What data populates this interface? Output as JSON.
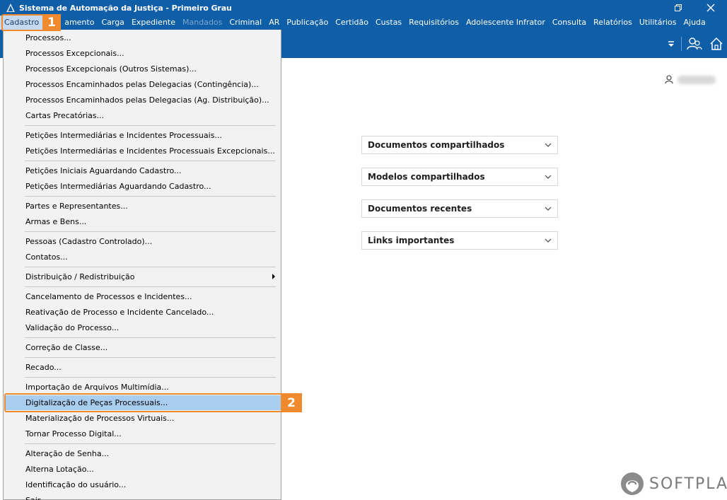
{
  "window": {
    "title": "Sistema de Automação da Justiça - Primeiro Grau"
  },
  "menubar": {
    "items": [
      {
        "label": "Cadastro",
        "state": "active"
      },
      {
        "label": "amento",
        "state": "normal"
      },
      {
        "label": "Carga",
        "state": "normal"
      },
      {
        "label": "Expediente",
        "state": "normal"
      },
      {
        "label": "Mandados",
        "state": "disabled"
      },
      {
        "label": "Criminal",
        "state": "normal"
      },
      {
        "label": "AR",
        "state": "normal"
      },
      {
        "label": "Publicação",
        "state": "normal"
      },
      {
        "label": "Certidão",
        "state": "normal"
      },
      {
        "label": "Custas",
        "state": "normal"
      },
      {
        "label": "Requisitórios",
        "state": "normal"
      },
      {
        "label": "Adolescente Infrator",
        "state": "normal"
      },
      {
        "label": "Consulta",
        "state": "normal"
      },
      {
        "label": "Relatórios",
        "state": "normal"
      },
      {
        "label": "Utilitários",
        "state": "normal"
      },
      {
        "label": "Ajuda",
        "state": "normal"
      }
    ]
  },
  "dropdown": {
    "items": [
      "Processos...",
      "Processos Excepcionais...",
      "Processos Excepcionais (Outros Sistemas)...",
      "Processos Encaminhados pelas Delegacias (Contingência)...",
      "Processos Encaminhados pelas Delegacias (Ag. Distribuição)...",
      "Cartas Precatórias...",
      "Petições Intermediárias e Incidentes Processuais...",
      "Petições Intermediárias e Incidentes Processuais Excepcionais...",
      "Petições Iniciais Aguardando Cadastro...",
      "Petições Intermediárias Aguardando Cadastro...",
      "Partes e Representantes...",
      "Armas e Bens...",
      "Pessoas (Cadastro Controlado)...",
      "Contatos...",
      "Distribuição / Redistribuição",
      "Cancelamento de Processos e Incidentes...",
      "Reativação de Processo e Incidente Cancelado...",
      "Validação do Processo...",
      "Correção de Classe...",
      "Recado...",
      "Importação de Arquivos Multimídia...",
      "Digitalização de Peças Processuais...",
      "Materialização de Processos Virtuais...",
      "Tornar Processo Digital...",
      "Alteração de Senha...",
      "Alterna Lotação...",
      "Identificação do usuário...",
      "Sair"
    ],
    "highlighted_index": 21
  },
  "panels": [
    {
      "title": "Documentos compartilhados"
    },
    {
      "title": "Modelos compartilhados"
    },
    {
      "title": "Documentos recentes"
    },
    {
      "title": "Links importantes"
    }
  ],
  "annotations": {
    "step1": "1",
    "step2": "2"
  },
  "logo": {
    "text": "SOFTPLAN"
  },
  "colors": {
    "titlebar": "#0e5ea8",
    "highlight": "#a8cdee",
    "callout": "#ef8a2f"
  }
}
